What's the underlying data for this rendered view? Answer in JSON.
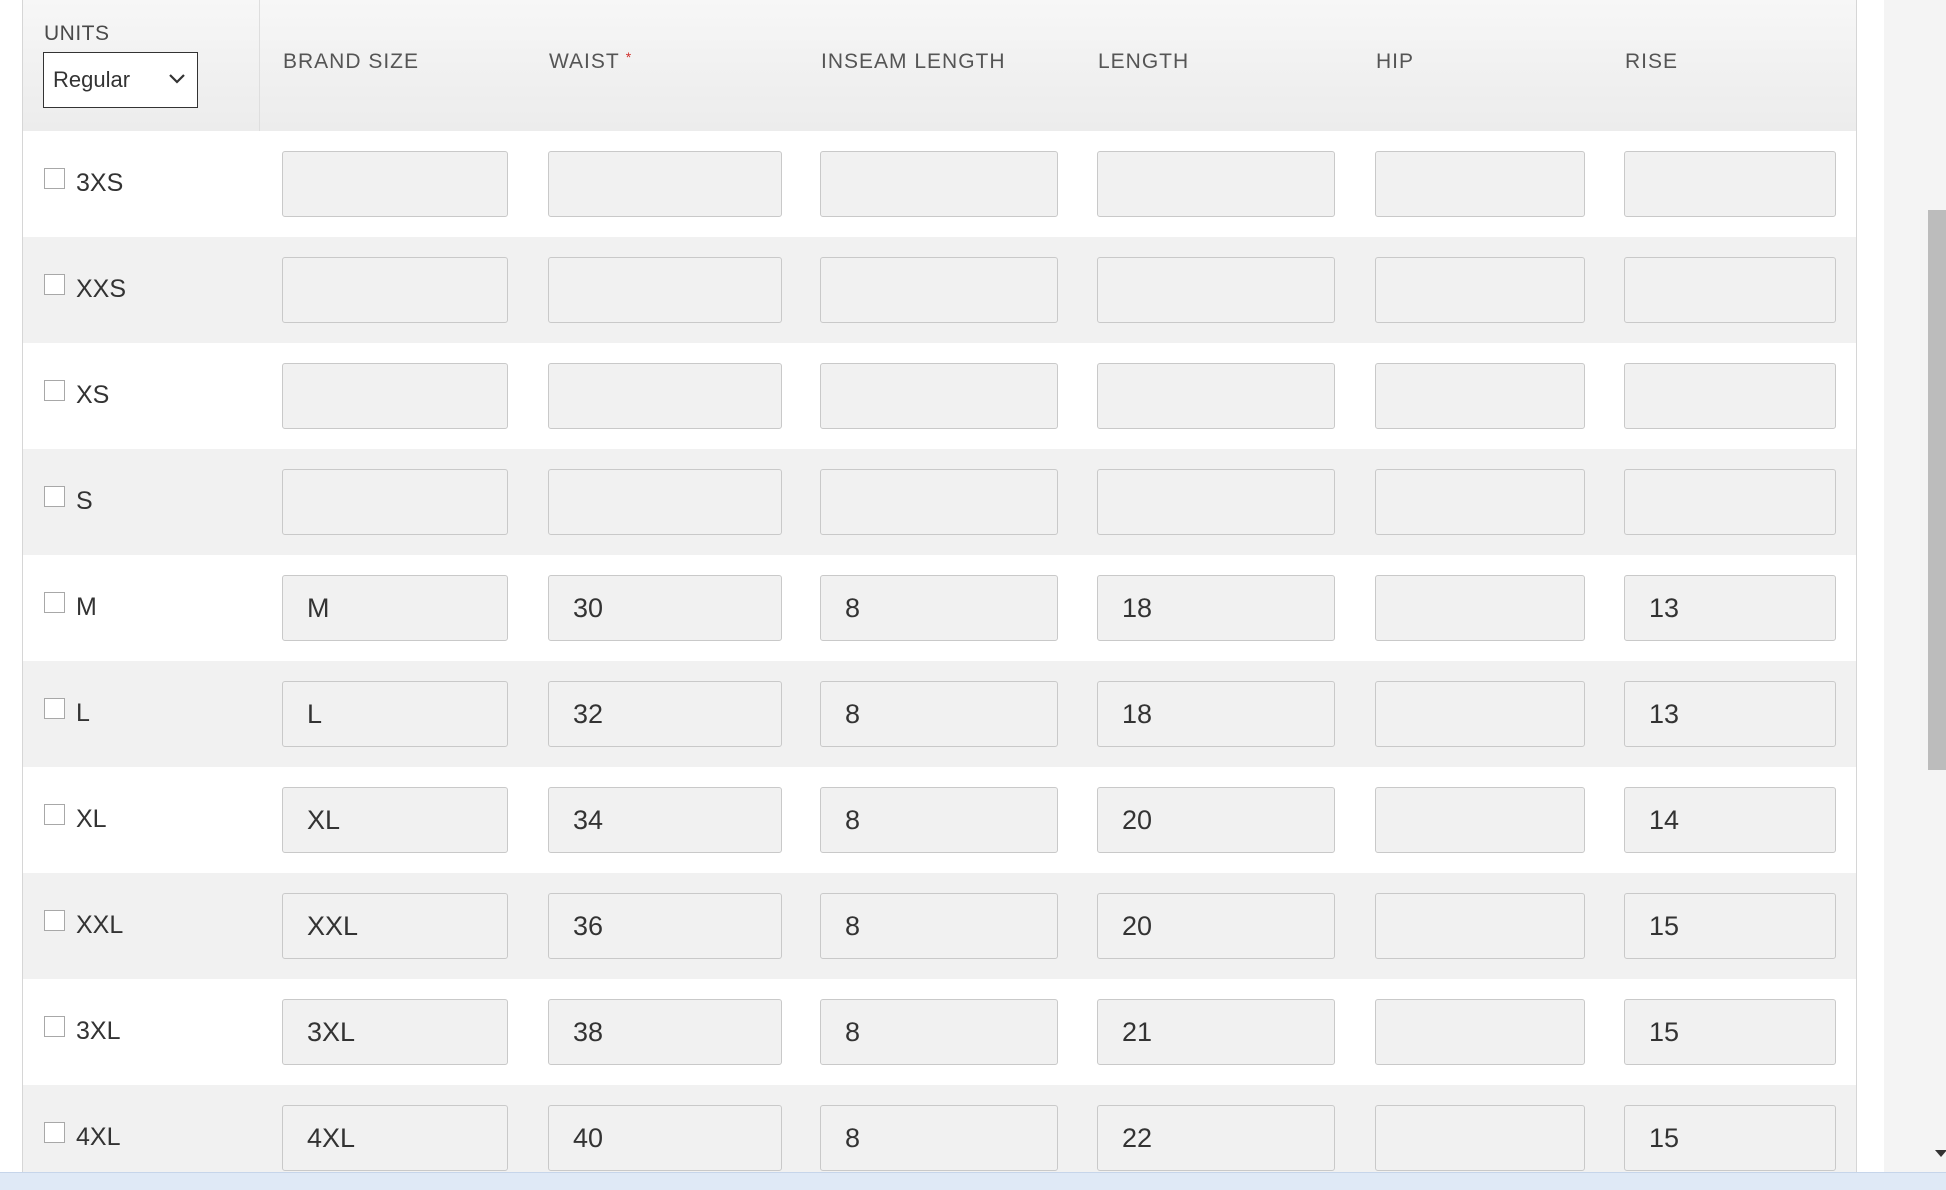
{
  "units": {
    "label": "UNITS",
    "selected": "Regular"
  },
  "columns": [
    {
      "label": "BRAND SIZE",
      "required": false
    },
    {
      "label": "WAIST",
      "required": true
    },
    {
      "label": "INSEAM LENGTH",
      "required": false
    },
    {
      "label": "LENGTH",
      "required": false
    },
    {
      "label": "HIP",
      "required": false
    },
    {
      "label": "RISE",
      "required": false
    }
  ],
  "required_marker": "*",
  "rows": [
    {
      "size": "3XS",
      "checked": false,
      "values": [
        "",
        "",
        "",
        "",
        "",
        ""
      ]
    },
    {
      "size": "XXS",
      "checked": false,
      "values": [
        "",
        "",
        "",
        "",
        "",
        ""
      ]
    },
    {
      "size": "XS",
      "checked": false,
      "values": [
        "",
        "",
        "",
        "",
        "",
        ""
      ]
    },
    {
      "size": "S",
      "checked": false,
      "values": [
        "",
        "",
        "",
        "",
        "",
        ""
      ]
    },
    {
      "size": "M",
      "checked": false,
      "values": [
        "M",
        "30",
        "8",
        "18",
        "",
        "13"
      ]
    },
    {
      "size": "L",
      "checked": false,
      "values": [
        "L",
        "32",
        "8",
        "18",
        "",
        "13"
      ]
    },
    {
      "size": "XL",
      "checked": false,
      "values": [
        "XL",
        "34",
        "8",
        "20",
        "",
        "14"
      ]
    },
    {
      "size": "XXL",
      "checked": false,
      "values": [
        "XXL",
        "36",
        "8",
        "20",
        "",
        "15"
      ]
    },
    {
      "size": "3XL",
      "checked": false,
      "values": [
        "3XL",
        "38",
        "8",
        "21",
        "",
        "15"
      ]
    },
    {
      "size": "4XL",
      "checked": false,
      "values": [
        "4XL",
        "40",
        "8",
        "22",
        "",
        "15"
      ]
    }
  ],
  "icons": {
    "select_arrow": "chevron-down-icon",
    "scroll_arrow": "scroll-down-arrow-icon"
  }
}
